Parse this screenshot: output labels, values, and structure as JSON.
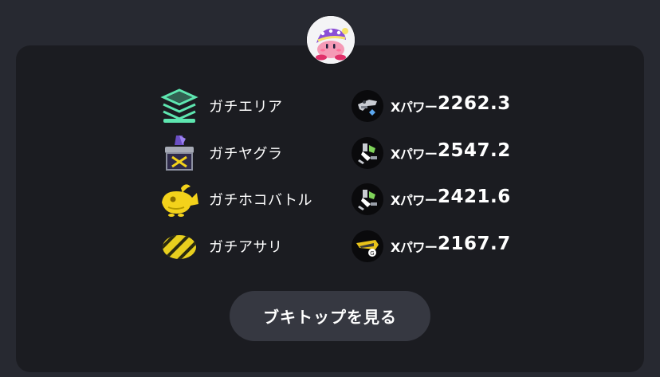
{
  "modes": [
    {
      "label": "ガチエリア",
      "icon": "splat-zones-icon",
      "weapon_icon": "weapon-icon-1",
      "xpower_label": "Xパワー",
      "xpower": "2262.3"
    },
    {
      "label": "ガチヤグラ",
      "icon": "tower-control-icon",
      "weapon_icon": "weapon-icon-2",
      "xpower_label": "Xパワー",
      "xpower": "2547.2"
    },
    {
      "label": "ガチホコバトル",
      "icon": "rainmaker-icon",
      "weapon_icon": "weapon-icon-3",
      "xpower_label": "Xパワー",
      "xpower": "2421.6"
    },
    {
      "label": "ガチアサリ",
      "icon": "clam-blitz-icon",
      "weapon_icon": "weapon-icon-4",
      "xpower_label": "Xパワー",
      "xpower": "2167.7"
    }
  ],
  "button": {
    "label": "ブキトップを見る"
  },
  "colors": {
    "page_bg": "#272931",
    "card_bg": "#1b1c21",
    "button_bg": "#363841",
    "zones": "#5ee6b0",
    "tower": "#6b4fc4",
    "gold": "#f3d21b"
  }
}
